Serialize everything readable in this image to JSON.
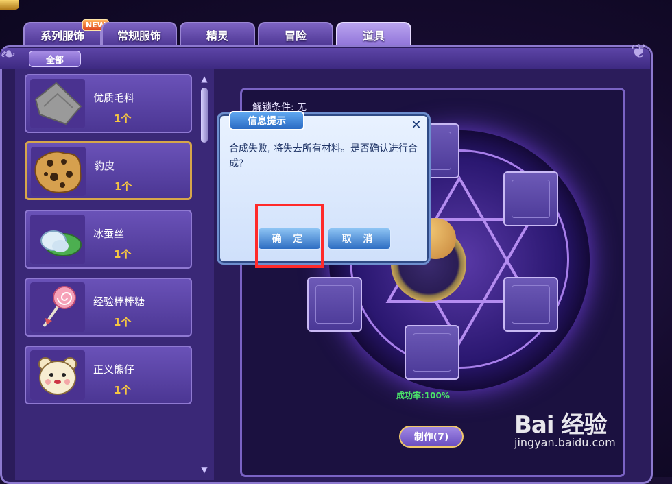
{
  "tabs": [
    {
      "label": "系列服饰",
      "badge": "NEW"
    },
    {
      "label": "常规服饰"
    },
    {
      "label": "精灵"
    },
    {
      "label": "冒险"
    },
    {
      "label": "道具",
      "active": true
    }
  ],
  "filter": {
    "label": "全部"
  },
  "items": [
    {
      "name": "优质毛料",
      "count": "1个",
      "icon": "cloth-icon"
    },
    {
      "name": "豹皮",
      "count": "1个",
      "icon": "leopard-skin-icon",
      "selected": true
    },
    {
      "name": "冰蚕丝",
      "count": "1个",
      "icon": "silkworm-icon"
    },
    {
      "name": "经验棒棒糖",
      "count": "1个",
      "icon": "lollipop-icon"
    },
    {
      "name": "正义熊仔",
      "count": "1个",
      "icon": "bear-icon"
    }
  ],
  "synthesis": {
    "unlock_text": "解锁条件: 无",
    "success_rate": "成功率:100%",
    "make_button": "制作(7)"
  },
  "dialog": {
    "title": "信息提示",
    "message": "合成失败, 将失去所有材料。是否确认进行合成?",
    "confirm": "确 定",
    "cancel": "取 消"
  },
  "watermark": {
    "brand": "Bai 经验",
    "site": "jingyan.baidu.com"
  },
  "colors": {
    "accent": "#7c63c2",
    "count": "#f5c542",
    "success": "#4be36a",
    "highlight": "#ff2a2a"
  }
}
